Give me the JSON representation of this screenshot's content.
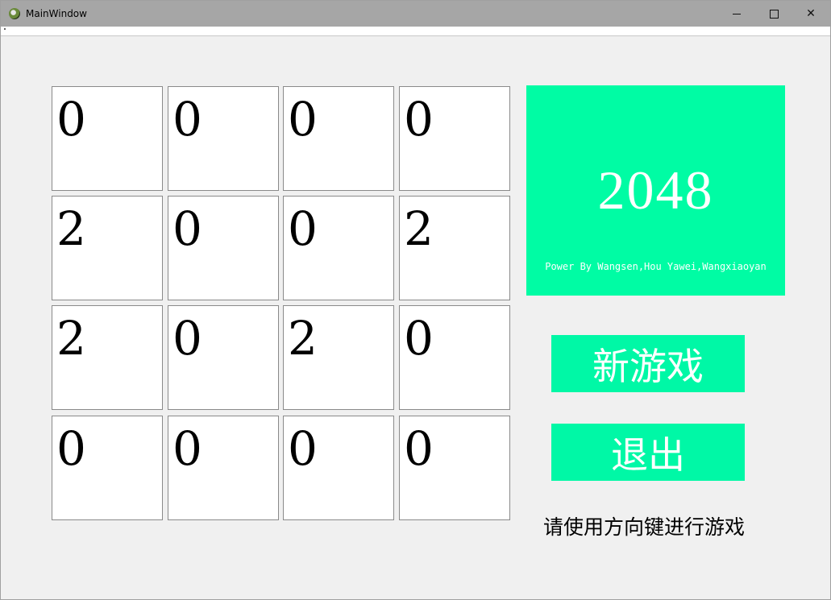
{
  "window": {
    "title": "MainWindow",
    "controls": {
      "minimize": "minimize",
      "maximize": "maximize",
      "close": "✕"
    }
  },
  "board": {
    "rows": [
      [
        "0",
        "0",
        "0",
        "0"
      ],
      [
        "2",
        "0",
        "0",
        "2"
      ],
      [
        "2",
        "0",
        "2",
        "0"
      ],
      [
        "0",
        "0",
        "0",
        "0"
      ]
    ]
  },
  "panel": {
    "title": "2048",
    "credit": "Power By Wangsen,Hou Yawei,Wangxiaoyan",
    "background": "#00fca4"
  },
  "buttons": {
    "new_game": "新游戏",
    "quit": "退出",
    "color": "#00f8a6"
  },
  "hint": "请使用方向键进行游戏"
}
